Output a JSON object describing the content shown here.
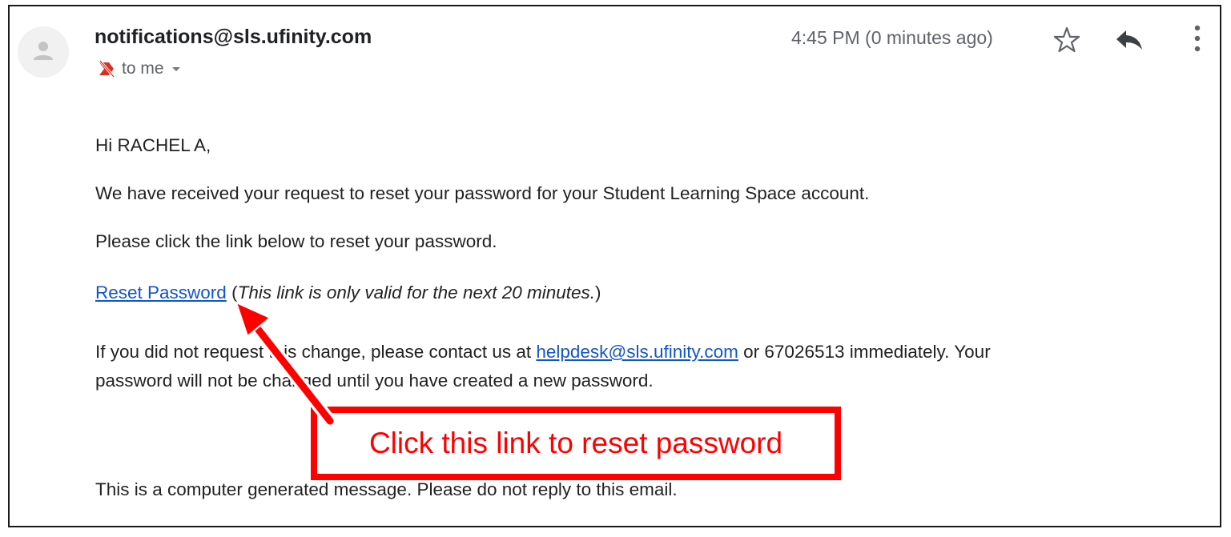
{
  "email": {
    "sender": "notifications@sls.ufinity.com",
    "recipient_label": "to me",
    "timestamp": "4:45 PM (0 minutes ago)"
  },
  "body": {
    "greeting": "Hi RACHEL A,",
    "paragraph1": "We have received your request to reset your password for your Student Learning Space account.",
    "paragraph2": "Please click the link below to reset your password.",
    "reset_link": "Reset Password",
    "reset_open_paren": " (",
    "reset_note": "This link is only valid for the next 20 minutes.",
    "reset_close_paren": ")",
    "paragraph4_part1": "If you did not request this change, please contact us at ",
    "helpdesk_email": "helpdesk@sls.ufinity.com",
    "paragraph4_part2": " or 67026513 immediately. Your",
    "paragraph4_line2": "password will not be changed until you have created a new password.",
    "footer": "This is a computer generated message. Please do not reply to this email."
  },
  "annotation": {
    "callout_text": "Click this link to reset password",
    "color": "#ff0000"
  },
  "icons": {
    "avatar": "person-icon",
    "label": "important-off-icon",
    "dropdown": "caret-down-icon",
    "star": "star-outline-icon",
    "reply": "reply-icon",
    "more": "more-vertical-icon"
  },
  "colors": {
    "link": "#1155cc",
    "muted": "#5f6368"
  }
}
